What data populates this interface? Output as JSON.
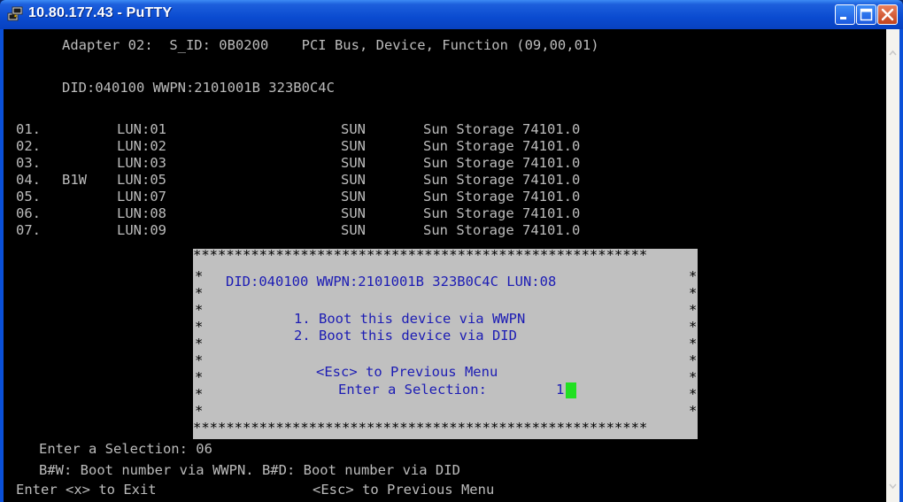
{
  "window": {
    "title": "10.80.177.43 - PuTTY",
    "icon": "putty-icon",
    "buttons": [
      "minimize-icon",
      "maximize-icon",
      "close-icon"
    ]
  },
  "terminal": {
    "header1": "Adapter 02:  S_ID: 0B0200    PCI Bus, Device, Function (09,00,01)",
    "header2": "DID:040100 WWPN:2101001B 323B0C4C",
    "rows": [
      {
        "num": "01.",
        "flag": "",
        "lun": "LUN:01",
        "vendor": "SUN",
        "product": "Sun Storage 74101.0"
      },
      {
        "num": "02.",
        "flag": "",
        "lun": "LUN:02",
        "vendor": "SUN",
        "product": "Sun Storage 74101.0"
      },
      {
        "num": "03.",
        "flag": "",
        "lun": "LUN:03",
        "vendor": "SUN",
        "product": "Sun Storage 74101.0"
      },
      {
        "num": "04.",
        "flag": "B1W",
        "lun": "LUN:05",
        "vendor": "SUN",
        "product": "Sun Storage 74101.0"
      },
      {
        "num": "05.",
        "flag": "",
        "lun": "LUN:07",
        "vendor": "SUN",
        "product": "Sun Storage 74101.0"
      },
      {
        "num": "06.",
        "flag": "",
        "lun": "LUN:08",
        "vendor": "SUN",
        "product": "Sun Storage 74101.0"
      },
      {
        "num": "07.",
        "flag": "",
        "lun": "LUN:09",
        "vendor": "SUN",
        "product": "Sun Storage 74101.0"
      }
    ],
    "prompt_line": "Enter a Selection: 06",
    "help_line": "B#W: Boot number via WWPN. B#D: Boot number via DID",
    "exit_hint": "Enter <x> to Exit",
    "esc_hint": "<Esc> to Previous Menu"
  },
  "dialog": {
    "border": "*******************************************************",
    "star": "*",
    "title": "DID:040100 WWPN:2101001B 323B0C4C LUN:08",
    "option1": "1. Boot this device via WWPN",
    "option2": "2. Boot this device via DID",
    "esc_hint": "<Esc> to Previous Menu",
    "prompt": "Enter a Selection:",
    "input_value": "1"
  },
  "colors": {
    "terminal_text": "#bcbcbc",
    "dialog_bg": "#c0c0c0",
    "dialog_text": "#1c1cb4",
    "cursor": "#22e022"
  }
}
